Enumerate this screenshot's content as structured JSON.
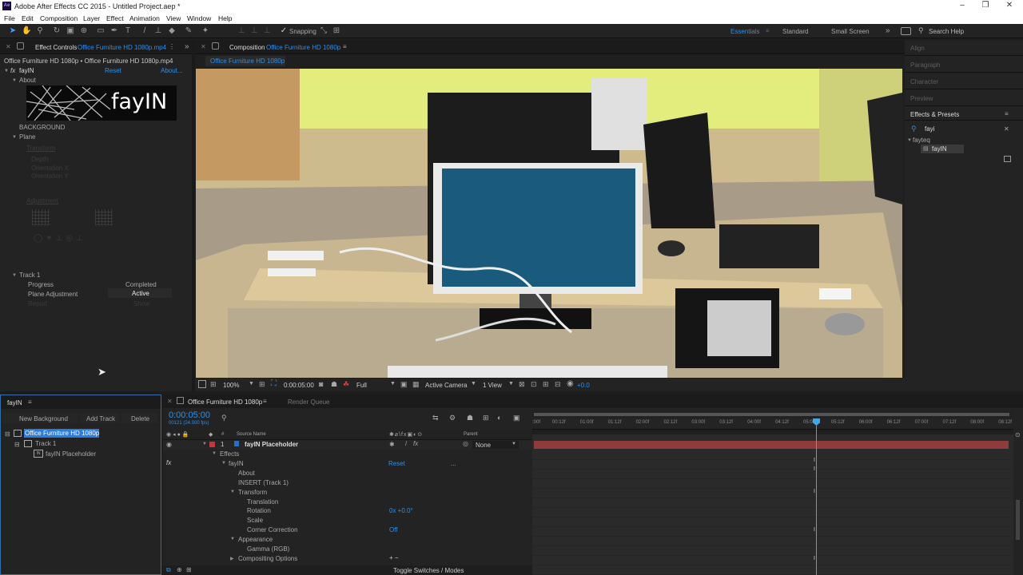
{
  "app": {
    "title": "Adobe After Effects CC 2015 - Untitled Project.aep *",
    "logo": "Ae"
  },
  "menu": [
    "File",
    "Edit",
    "Composition",
    "Layer",
    "Effect",
    "Animation",
    "View",
    "Window",
    "Help"
  ],
  "toolbar": {
    "snapping": "Snapping",
    "workspaces": [
      "Essentials",
      "Standard",
      "Small Screen"
    ],
    "search_placeholder": "Search Help"
  },
  "effect_controls": {
    "tab": "Effect Controls",
    "file": "Office Furniture HD 1080p.mp4",
    "breadcrumb": "Office Furniture HD 1080p • Office Furniture HD 1080p.mp4",
    "effect_name": "fayIN",
    "reset": "Reset",
    "about_link": "About...",
    "about": "About",
    "logo_text": "fayIN",
    "background": "BACKGROUND",
    "plane": "Plane",
    "disabled": [
      "Transform",
      "Depth",
      "Orientation X",
      "Orientation Y"
    ],
    "adjustment": "Adjustment",
    "track": "Track 1",
    "progress_label": "Progress",
    "progress_value": "Completed",
    "plane_adjust_label": "Plane Adjustment",
    "plane_adjust_value": "Active",
    "report_label": "Report",
    "report_value": "Show"
  },
  "composition": {
    "tab": "Composition",
    "name": "Office Furniture HD 1080p",
    "subtab": "Office Furniture HD 1080p",
    "zoom": "100%",
    "timecode": "0:00:05:00",
    "resolution": "Full",
    "camera": "Active Camera",
    "view": "1 View",
    "exposure": "+0.0"
  },
  "right_panel": {
    "items": [
      "Align",
      "Paragraph",
      "Character",
      "Preview"
    ],
    "effects_presets": "Effects & Presets",
    "search": "fayi",
    "folder": "fayteq",
    "item": "fayIN"
  },
  "fayin_panel": {
    "title": "fayIN",
    "buttons": [
      "New Background",
      "Add Track",
      "Delete"
    ],
    "tree": [
      "Office Furniture HD 1080p",
      "Track 1",
      "fayIN Placeholder"
    ]
  },
  "timeline": {
    "tab": "Office Furniture HD 1080p",
    "render_queue": "Render Queue",
    "timecode": "0:00:05:00",
    "frames": "00121 (24.000 fps)",
    "col_num": "#",
    "col_source": "Source Name",
    "col_parent": "Parent",
    "layer_num": "1",
    "layer_name": "fayIN Placeholder",
    "parent_value": "None",
    "effects": "Effects",
    "fayin": "fayIN",
    "reset": "Reset",
    "reset_dots": "...",
    "props": [
      "About",
      "INSERT (Track 1)",
      "Transform",
      "Translation",
      "Rotation",
      "Scale",
      "Corner Correction",
      "Appearance",
      "Gamma (RGB)",
      "Compositing Options"
    ],
    "rotation_value": "0x +0.0°",
    "corner_value": "Off",
    "toggle": "Toggle Switches / Modes",
    "ruler": [
      ":00f",
      "00:12f",
      "01:00f",
      "01:12f",
      "02:00f",
      "02:12f",
      "03:00f",
      "03:12f",
      "04:00f",
      "04:12f",
      "05:00f",
      "05:12f",
      "06:00f",
      "06:12f",
      "07:00f",
      "07:12f",
      "08:00f",
      "08:12f"
    ],
    "compositing_sym": "+ −"
  },
  "colors": {
    "accent": "#2f8fe8",
    "layer_bar": "#8e3b3d",
    "playhead": "#41a7e6"
  }
}
